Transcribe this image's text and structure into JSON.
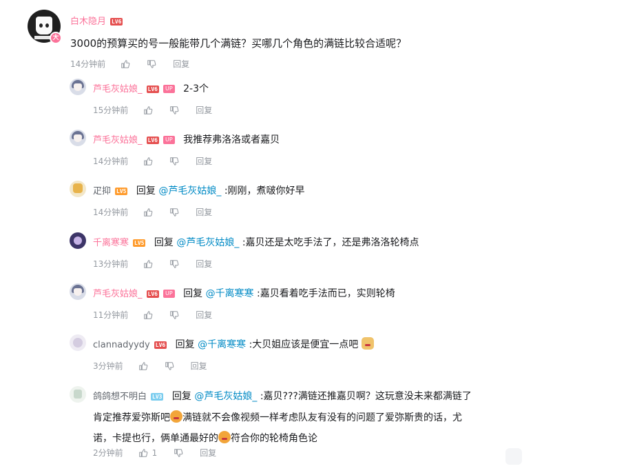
{
  "main": {
    "username": "白木隐月",
    "level": "LV6",
    "vip_badge": "大",
    "text": "3000的预算买的号一般能带几个满链？买哪几个角色的满链比较合适呢？",
    "time": "14分钟前",
    "reply_label": "回复"
  },
  "replies": [
    {
      "username": "芦毛灰姑娘_",
      "level": "LV6",
      "up": "UP",
      "prefix": "",
      "mention": "",
      "text": "2-3个",
      "time": "15分钟前",
      "likes": "",
      "reply_label": "回复"
    },
    {
      "username": "芦毛灰姑娘_",
      "level": "LV6",
      "up": "UP",
      "prefix": "",
      "mention": "",
      "text": "我推荐弗洛洛或者嘉贝",
      "time": "14分钟前",
      "likes": "",
      "reply_label": "回复"
    },
    {
      "username": "疋抑",
      "level": "LV5",
      "up": "",
      "prefix": "回复 ",
      "mention": "@芦毛灰姑娘_",
      "text": " :刚刚，煮啵你好早",
      "time": "14分钟前",
      "likes": "",
      "reply_label": "回复"
    },
    {
      "username": "千离寒寒",
      "level": "LV5",
      "up": "",
      "prefix": "回复 ",
      "mention": "@芦毛灰姑娘_",
      "text": " :嘉贝还是太吃手法了，还是弗洛洛轮椅点",
      "time": "13分钟前",
      "likes": "",
      "reply_label": "回复"
    },
    {
      "username": "芦毛灰姑娘_",
      "level": "LV6",
      "up": "UP",
      "prefix": "回复 ",
      "mention": "@千离寒寒",
      "text": " :嘉贝看着吃手法而已，实则轮椅",
      "time": "11分钟前",
      "likes": "",
      "reply_label": "回复"
    },
    {
      "username": "clannadyydy",
      "level": "LV6",
      "up": "",
      "prefix": "回复 ",
      "mention": "@千离寒寒",
      "text": " :大贝姐应该是便宜一点吧",
      "time": "3分钟前",
      "likes": "",
      "reply_label": "回复"
    },
    {
      "username": "鸽鸽想不明白",
      "level": "LV3",
      "up": "",
      "prefix": "回复 ",
      "mention": "@芦毛灰姑娘_",
      "text": " :嘉贝???满链还推嘉贝啊？这玩意没未来都满链了肯定推荐爱弥斯吧",
      "text2": "满链就不会像视频一样考虑队友有没有的问题了爱弥斯贵的话，尤诺，卡提也行，俩单通最好的",
      "text3": "符合你的轮椅角色论",
      "time": "2分钟前",
      "likes": "1",
      "reply_label": "回复"
    }
  ],
  "icons": {
    "like": "thumb-up-icon",
    "dislike": "thumb-down-icon",
    "emoji": "sticker-emoji-icon"
  },
  "colors": {
    "accent_pink": "#fb7299",
    "mention_blue": "#008ac5",
    "meta_gray": "#9499a0"
  }
}
